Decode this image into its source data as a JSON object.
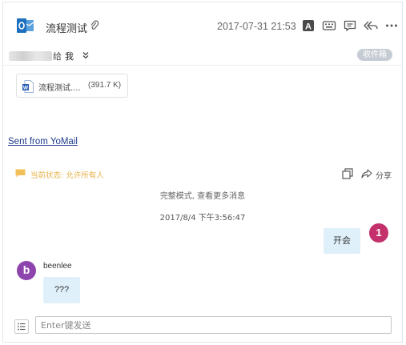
{
  "email": {
    "subject": "流程测试",
    "date": "2017-07-31 21:53",
    "recipient_suffix": "给",
    "recipient_me": "我",
    "folder_tag": "收件箱"
  },
  "attachment": {
    "name": "流程测试....",
    "size": "(391.7 K)"
  },
  "body": {
    "signature_link": "Sent from YoMail"
  },
  "chat": {
    "state_text": "当前状态: 允许所有人",
    "share_label": "分享",
    "full_mode_text": "完整模式, 查看更多消息",
    "timestamp": "2017/8/4 下午3:56:47",
    "messages": [
      {
        "side": "right",
        "text": "开会",
        "badge": "1"
      },
      {
        "side": "left",
        "avatar": "b",
        "sender": "beenlee",
        "text": "???"
      }
    ],
    "input_placeholder": "Enter键发送"
  },
  "colors": {
    "bubble": "#dff0fb",
    "badge_pink": "#c3306b",
    "avatar_purple": "#8e44ad",
    "state_yellow": "#e6b34c",
    "link": "#1f3b8a",
    "folder_tag_bg": "#c6ccd3"
  },
  "icons": {
    "app": "outlook-icon",
    "attachment": "paperclip-icon",
    "toolbar": [
      "font-a-icon",
      "keyboard-icon",
      "comment-icon",
      "reply-all-icon",
      "more-icon"
    ],
    "file": "word-file-icon",
    "chat_state": "chat-bubble-icon",
    "copy": "copy-icon",
    "share": "share-icon",
    "input_menu": "list-icon"
  }
}
